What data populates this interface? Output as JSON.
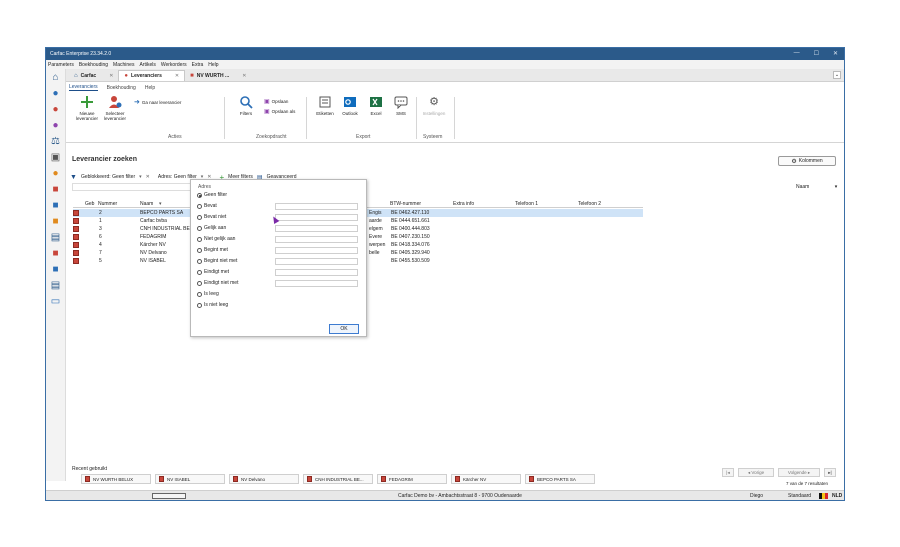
{
  "window": {
    "title": "Carfac Enterprise 23.34.2.0",
    "controls": [
      "—",
      "☐",
      "✕"
    ]
  },
  "menu": [
    "Parameters",
    "Boekhouding",
    "Machines",
    "Artikels",
    "Werkorders",
    "Extra",
    "Help"
  ],
  "tabs": [
    {
      "label": "Carfac",
      "close": "✕"
    },
    {
      "label": "Leveranciers",
      "close": "✕"
    },
    {
      "label": "NV WURTH ...",
      "close": "✕"
    }
  ],
  "ribbon_tabs": [
    "Leveranciers",
    "Boekhouding",
    "Help"
  ],
  "ribbon": {
    "new_supplier": "Nieuwe leverancier",
    "select_supplier": "Selecteer leverancier",
    "goto_supplier": "Ga naar leverancier",
    "group_actions": "Acties",
    "filters": "Filters",
    "save": "Opslaan",
    "save_as": "Opslaan als",
    "group_search": "Zoekopdracht",
    "labels": "Etiketten",
    "outlook": "Outlook",
    "excel": "Excel",
    "sms": "SMS",
    "group_export": "Export",
    "settings": "Instellingen",
    "group_system": "Systeem"
  },
  "page": {
    "title": "Leverancier zoeken",
    "columns_button": "Kolommen",
    "sort_label": "Naam",
    "sort_caret": "▾"
  },
  "filters": {
    "blocked": "Geblokkeerd: Geen filter",
    "address": "Adres: Geen filter",
    "more": "Meer filters",
    "advanced": "Geavanceerd",
    "caret": "▾",
    "clear": "✕"
  },
  "grid": {
    "headers": [
      "Geb",
      "Nummer",
      "Naam",
      "BTW-nummer",
      "Extra info",
      "Telefoon 1",
      "Telefoon 2"
    ],
    "rows": [
      {
        "number": "2",
        "name": "BEPCO PARTS SA",
        "city": "Engis",
        "vat": "BE 0462.427.110",
        "selected": true
      },
      {
        "number": "1",
        "name": "Carfac bvba",
        "city": "aarde",
        "vat": "BE 0444.651.661",
        "selected": false
      },
      {
        "number": "3",
        "name": "CNH INDUSTRIAL BE",
        "city": "elgem",
        "vat": "BE 0400.444.803",
        "selected": false
      },
      {
        "number": "6",
        "name": "FEDAGRIM",
        "city": "Evere",
        "vat": "BE 0407.230.150",
        "selected": false
      },
      {
        "number": "4",
        "name": "Kärcher NV",
        "city": "werpen",
        "vat": "BE 0418.334.076",
        "selected": false
      },
      {
        "number": "7",
        "name": "NV Delvano",
        "city": "belle",
        "vat": "BE 0405.329.940",
        "selected": false
      },
      {
        "number": "5",
        "name": "NV ISABEL",
        "city": "",
        "vat": "BE 0455.530.509",
        "selected": false
      }
    ]
  },
  "filter_dialog": {
    "title": "Adres",
    "options": [
      "Geen filter",
      "Bevat",
      "Bevat niet",
      "Gelijk aan",
      "Niet gelijk aan",
      "Begint met",
      "Begint niet met",
      "Eindigt met",
      "Eindigt niet met",
      "Is leeg",
      "Is niet leeg"
    ],
    "selected": "Geen filter",
    "ok": "OK"
  },
  "recent": {
    "label": "Recent gebruikt",
    "items": [
      "NV WURTH BELUX",
      "NV ISABEL",
      "NV Delvano",
      "CNH INDUSTRIAL BE...",
      "FEDAGRIM",
      "Kärcher NV",
      "BEPCO PARTS SA"
    ]
  },
  "pager": {
    "first": "|◂",
    "prev": "◂ Vorige",
    "next": "Volgende ▸",
    "last": "▸|",
    "results": "7 van de 7 resultaten"
  },
  "status": {
    "company": "Carfac Demo bv - Ambachtsstraat 8 - 9700 Oudenaarde",
    "user": "Diego",
    "mode": "Standaard",
    "lang": "NLD"
  },
  "colors": {
    "titlebar": "#2b5a8a",
    "accent": "#1d4e89",
    "selected_row": "#cfe3f7",
    "supplier_mark": "#c8463b"
  }
}
